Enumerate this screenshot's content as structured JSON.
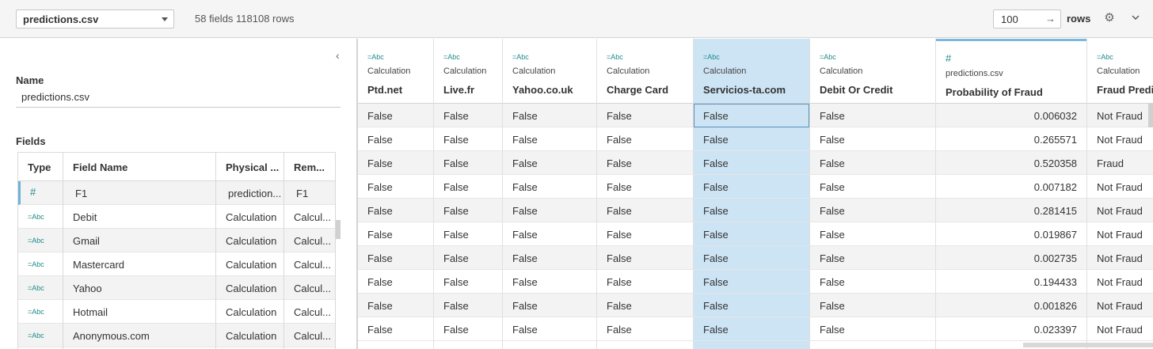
{
  "toolbar": {
    "datasource": "predictions.csv",
    "summary": "58 fields 118108 rows",
    "rows_value": "100",
    "rows_arrow": "→",
    "rows_label": "rows",
    "gear_icon": "gear-icon",
    "chevron_icon": "chevron-down-icon"
  },
  "left_panel": {
    "collapse_glyph": "‹",
    "name_label": "Name",
    "name_value": "predictions.csv",
    "fields_label": "Fields",
    "columns": [
      "Type",
      "Field Name",
      "Physical ...",
      "Rem..."
    ],
    "rows": [
      {
        "type": "#",
        "name": "F1",
        "physical": "prediction...",
        "remote": "F1"
      },
      {
        "type": "=Abc",
        "name": "Debit",
        "physical": "Calculation",
        "remote": "Calcul..."
      },
      {
        "type": "=Abc",
        "name": "Gmail",
        "physical": "Calculation",
        "remote": "Calcul..."
      },
      {
        "type": "=Abc",
        "name": "Mastercard",
        "physical": "Calculation",
        "remote": "Calcul..."
      },
      {
        "type": "=Abc",
        "name": "Yahoo",
        "physical": "Calculation",
        "remote": "Calcul..."
      },
      {
        "type": "=Abc",
        "name": "Hotmail",
        "physical": "Calculation",
        "remote": "Calcul..."
      },
      {
        "type": "=Abc",
        "name": "Anonymous.com",
        "physical": "Calculation",
        "remote": "Calcul..."
      }
    ]
  },
  "grid": {
    "columns": [
      {
        "icon": "=Abc",
        "source": "Calculation",
        "name": "Ptd.net"
      },
      {
        "icon": "=Abc",
        "source": "Calculation",
        "name": "Live.fr"
      },
      {
        "icon": "=Abc",
        "source": "Calculation",
        "name": "Yahoo.co.uk"
      },
      {
        "icon": "=Abc",
        "source": "Calculation",
        "name": "Charge Card"
      },
      {
        "icon": "=Abc",
        "source": "Calculation",
        "name": "Servicios-ta.com"
      },
      {
        "icon": "=Abc",
        "source": "Calculation",
        "name": "Debit Or Credit"
      },
      {
        "icon": "#",
        "source": "predictions.csv",
        "name": "Probability of Fraud"
      },
      {
        "icon": "=Abc",
        "source": "Calculation",
        "name": "Fraud Predic"
      }
    ],
    "rows": [
      [
        "False",
        "False",
        "False",
        "False",
        "False",
        "False",
        "0.006032",
        "Not Fraud"
      ],
      [
        "False",
        "False",
        "False",
        "False",
        "False",
        "False",
        "0.265571",
        "Not Fraud"
      ],
      [
        "False",
        "False",
        "False",
        "False",
        "False",
        "False",
        "0.520358",
        "Fraud"
      ],
      [
        "False",
        "False",
        "False",
        "False",
        "False",
        "False",
        "0.007182",
        "Not Fraud"
      ],
      [
        "False",
        "False",
        "False",
        "False",
        "False",
        "False",
        "0.281415",
        "Not Fraud"
      ],
      [
        "False",
        "False",
        "False",
        "False",
        "False",
        "False",
        "0.019867",
        "Not Fraud"
      ],
      [
        "False",
        "False",
        "False",
        "False",
        "False",
        "False",
        "0.002735",
        "Not Fraud"
      ],
      [
        "False",
        "False",
        "False",
        "False",
        "False",
        "False",
        "0.194433",
        "Not Fraud"
      ],
      [
        "False",
        "False",
        "False",
        "False",
        "False",
        "False",
        "0.001826",
        "Not Fraud"
      ],
      [
        "False",
        "False",
        "False",
        "False",
        "False",
        "False",
        "0.023397",
        "Not Fraud"
      ]
    ]
  },
  "colors": {
    "accent": "#1f8a8a",
    "selected_column": "#cde4f5",
    "header_topline": "#7bb8df"
  }
}
